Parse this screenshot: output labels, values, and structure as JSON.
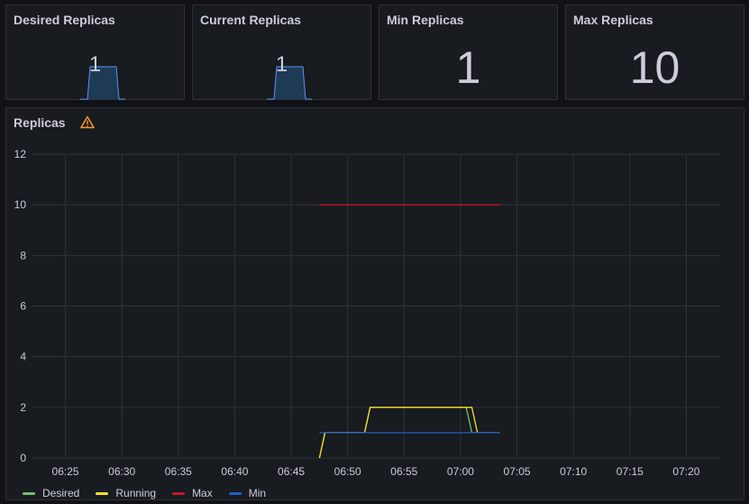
{
  "panels": {
    "desired": {
      "title": "Desired Replicas",
      "value": "1"
    },
    "current": {
      "title": "Current Replicas",
      "value": "1"
    },
    "min": {
      "title": "Min Replicas",
      "value": "1"
    },
    "max": {
      "title": "Max Replicas",
      "value": "10"
    },
    "replicas": {
      "title": "Replicas",
      "warning_icon": "warning-triangle-icon"
    }
  },
  "colors": {
    "desired": "#73bf69",
    "running": "#fade2a",
    "max": "#c4162a",
    "min": "#1f60c4",
    "warning": "#ff9830",
    "spark_line": "#5794f2",
    "spark_fill": "#1f3a55"
  },
  "legend": [
    {
      "key": "desired",
      "label": "Desired"
    },
    {
      "key": "running",
      "label": "Running"
    },
    {
      "key": "max",
      "label": "Max"
    },
    {
      "key": "min",
      "label": "Min"
    }
  ],
  "chart_data": {
    "type": "line",
    "ylim": [
      0,
      12
    ],
    "yticks": [
      0,
      2,
      4,
      6,
      8,
      10,
      12
    ],
    "xlim": [
      "06:22",
      "07:23"
    ],
    "xticks": [
      "06:25",
      "06:30",
      "06:35",
      "06:40",
      "06:45",
      "06:50",
      "06:55",
      "07:00",
      "07:05",
      "07:10",
      "07:15",
      "07:20"
    ],
    "series": [
      {
        "name": "Desired",
        "key": "desired",
        "x": [
          "06:47:30",
          "06:48",
          "06:51:30",
          "06:52",
          "07:00:30",
          "07:01",
          "07:03:30"
        ],
        "y": [
          0,
          1,
          1,
          2,
          2,
          1,
          1
        ]
      },
      {
        "name": "Running",
        "key": "running",
        "x": [
          "06:47:30",
          "06:48",
          "06:51:30",
          "06:52",
          "07:01",
          "07:01:30"
        ],
        "y": [
          0,
          1,
          1,
          2,
          2,
          1
        ]
      },
      {
        "name": "Max",
        "key": "max",
        "x": [
          "06:47:30",
          "07:03:30"
        ],
        "y": [
          10,
          10
        ]
      },
      {
        "name": "Min",
        "key": "min",
        "x": [
          "06:47:30",
          "07:03:30"
        ],
        "y": [
          1,
          1
        ]
      }
    ]
  }
}
